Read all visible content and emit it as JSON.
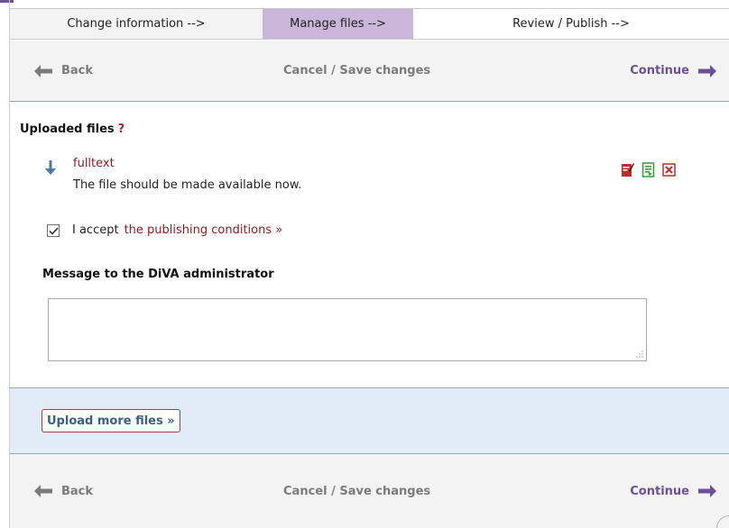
{
  "steps": [
    {
      "label": "Change information -->"
    },
    {
      "label": "Manage files -->"
    },
    {
      "label": "Review / Publish -->"
    }
  ],
  "nav": {
    "back_label": "Back",
    "cancel_label": "Cancel / Save changes",
    "continue_label": "Continue"
  },
  "uploaded": {
    "title": "Uploaded files",
    "help_label": "?",
    "file_name": "fulltext",
    "file_note": "The file should be made available now.",
    "actions": [
      "edit-icon",
      "document-icon",
      "delete-icon"
    ]
  },
  "accept": {
    "checked": true,
    "text": "I accept",
    "link": "the publishing conditions »"
  },
  "message": {
    "label": "Message to the DiVA administrator",
    "value": ""
  },
  "upload_more": {
    "label": "Upload more files »"
  },
  "colors": {
    "accent": "#6d4f96",
    "active_step": "#c9b6d8",
    "link_red": "#8e1a1e",
    "panel_blue": "#e2ecf6"
  }
}
